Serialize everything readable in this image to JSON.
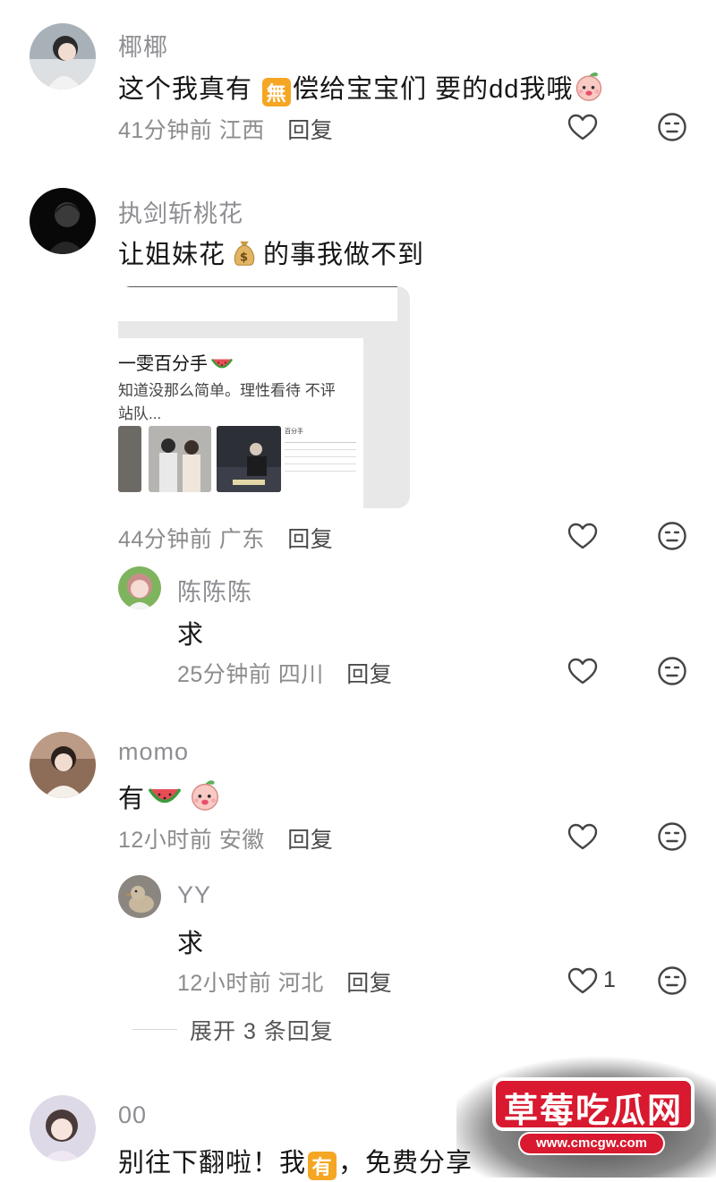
{
  "comments": [
    {
      "username": "椰椰",
      "text_a": "这个我真有",
      "badge": "無",
      "text_b": "偿给宝宝们 要的dd我哦",
      "time": "41分钟前",
      "location": "江西",
      "reply": "回复"
    },
    {
      "username": "执剑斩桃花",
      "text_a": "让姐妹花",
      "text_b": "的事我做不到",
      "time": "44分钟前",
      "location": "广东",
      "reply": "回复",
      "card": {
        "title": "一雯百分手",
        "line1": "知道没那么简单。理性看待 不评",
        "line2": "站队...",
        "mini_title": "百分手"
      }
    },
    {
      "username": "momo",
      "text": "有",
      "time": "12小时前",
      "location": "安徽",
      "reply": "回复"
    },
    {
      "username": "00",
      "text_a": "别往下翻啦！我",
      "badge": "有",
      "text_b": "，免费分享"
    }
  ],
  "replies": [
    {
      "username": "陈陈陈",
      "text": "求",
      "time": "25分钟前",
      "location": "四川",
      "reply": "回复"
    },
    {
      "username": "YY",
      "text": "求",
      "time": "12小时前",
      "location": "河北",
      "reply": "回复",
      "likes": "1"
    }
  ],
  "expand": "展开 3 条回复",
  "watermark": {
    "title": "草莓吃瓜网",
    "url": "www.cmcgw.com"
  },
  "colors": {
    "badge_orange": "#f5a623",
    "watermark_red": "#d8192f"
  },
  "icons": [
    "heart-icon",
    "dislike-face-icon",
    "peach-emoji",
    "watermelon-emoji",
    "money-bag-emoji"
  ]
}
